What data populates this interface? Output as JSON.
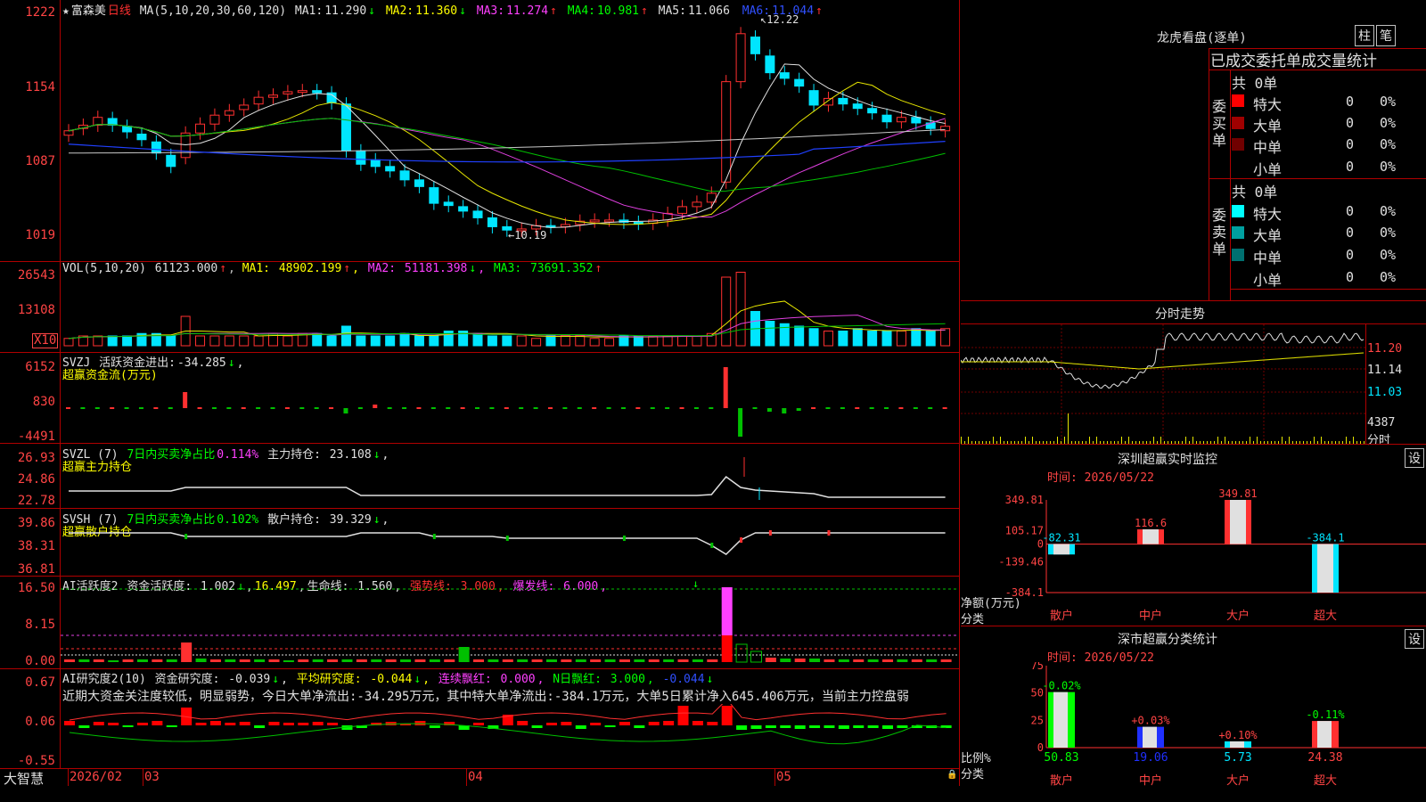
{
  "stock": {
    "star": "★",
    "name": "富森美",
    "period": "日线"
  },
  "ma": {
    "params": "MA(5,10,20,30,60,120)",
    "items": [
      {
        "label": "MA1:",
        "value": "11.290",
        "arrow": "↓",
        "color": "#e0e0e0"
      },
      {
        "label": "MA2:",
        "value": "11.360",
        "arrow": "↓",
        "color": "#ffff00"
      },
      {
        "label": "MA3:",
        "value": "11.274",
        "arrow": "↑",
        "color": "#ff40ff"
      },
      {
        "label": "MA4:",
        "value": "10.981",
        "arrow": "↑",
        "color": "#00ff00"
      },
      {
        "label": "MA5:",
        "value": "11.066",
        "arrow": "",
        "color": "#e0e0e0"
      },
      {
        "label": "MA6:",
        "value": "11.044",
        "arrow": "↑",
        "color": "#3050ff"
      }
    ]
  },
  "price_axis": [
    "1222",
    "1154",
    "1087",
    "1019"
  ],
  "price_marks": {
    "high": "12.22",
    "low": "10.19"
  },
  "vol": {
    "label": "VOL(5,10,20)",
    "value": "61123.000",
    "arrow": "↑",
    "items": [
      {
        "label": "MA1:",
        "value": "48902.199",
        "arrow": "↑",
        "color": "#ffff00"
      },
      {
        "label": "MA2:",
        "value": "51181.398",
        "arrow": "↓",
        "color": "#ff40ff"
      },
      {
        "label": "MA3:",
        "value": "73691.352",
        "arrow": "↑",
        "color": "#00ff00"
      }
    ],
    "axis": [
      "26543",
      "13108"
    ],
    "unit": "X10"
  },
  "svzj": {
    "label": "SVZJ",
    "text": "活跃资金进出:",
    "value": "-34.285",
    "arrow": "↓",
    "suffix": ",",
    "sub": "超赢资金流(万元)",
    "axis": [
      "6152",
      "830",
      "-4491"
    ]
  },
  "svzl": {
    "label": "SVZL (7)",
    "text1": "7日内买卖净占比",
    "v1": "0.114%",
    "text2": "主力持仓:",
    "v2": "23.108",
    "arrow": "↓",
    "suffix": ",",
    "sub": "超赢主力持仓",
    "axis": [
      "26.93",
      "24.86",
      "22.78"
    ]
  },
  "svsh": {
    "label": "SVSH (7)",
    "text1": "7日内买卖净占比",
    "v1": "0.102%",
    "text2": "散户持仓:",
    "v2": "39.329",
    "arrow": "↓",
    "suffix": ",",
    "sub": "超赢散户持仓",
    "axis": [
      "39.86",
      "38.31",
      "36.81"
    ]
  },
  "ai1": {
    "label": "AI活跃度2",
    "t1": "资金活跃度:",
    "v1": "1.002",
    "a1": "↓",
    "suffix1": ",",
    "v2": "16.497",
    "suffix2": ",",
    "t3": "生命线:",
    "v3": "1.560",
    "suffix3": ",",
    "t4": "强势线:",
    "v4": "3.000",
    "suffix4": ",",
    "t5": "爆发线:",
    "v5": "6.000",
    "suffix5": ",",
    "axis": [
      "16.50",
      "8.15",
      "0.00"
    ]
  },
  "ai2": {
    "label": "AI研究度2(10)",
    "t1": "资金研究度:",
    "v1": "-0.039",
    "a1": "↓",
    "suffix1": ",",
    "t2": "平均研究度:",
    "v2": "-0.044",
    "a2": "↓",
    "suffix2": ",",
    "t3": "连续飘红:",
    "v3": "0.000",
    "suffix3": ",",
    "t4": "N日飘红:",
    "v4": "3.000",
    "suffix4": ",",
    "v5": "-0.044",
    "a5": "↓",
    "axis": [
      "0.67",
      "0.06",
      "-0.55"
    ],
    "comment": "近期大资金关注度较低，明显弱势，今日大单净流出:-34.295万元，其中特大单净流出:-384.1万元，大单5日累计净入645.406万元，当前主力控盘弱"
  },
  "bottom": {
    "brand": "大智慧",
    "dates": [
      "2026/02",
      "03",
      "04",
      "05"
    ]
  },
  "lhb": {
    "title": "龙虎看盘(逐单)",
    "btn1": "柱",
    "btn2": "笔",
    "tabs": "已成交委托单成交量统计",
    "buy": {
      "side": "委买单",
      "total": "共 0单",
      "rows": [
        {
          "name": "特大",
          "v": "0",
          "p": "0%"
        },
        {
          "name": "大单",
          "v": "0",
          "p": "0%"
        },
        {
          "name": "中单",
          "v": "0",
          "p": "0%"
        },
        {
          "name": "小单",
          "v": "0",
          "p": "0%"
        }
      ]
    },
    "sell": {
      "side": "委卖单",
      "total": "共 0单",
      "rows": [
        {
          "name": "特大",
          "v": "0",
          "p": "0%"
        },
        {
          "name": "大单",
          "v": "0",
          "p": "0%"
        },
        {
          "name": "中单",
          "v": "0",
          "p": "0%"
        },
        {
          "name": "小单",
          "v": "0",
          "p": "0%"
        }
      ]
    }
  },
  "intraday": {
    "title": "分时走势",
    "axis": [
      "11.20",
      "11.14",
      "11.03"
    ],
    "vol": "4387",
    "vol_unit": "分时"
  },
  "monitor": {
    "title": "深圳超赢实时监控",
    "settings": "设",
    "time": "时间: 2026/05/22",
    "ylabel": "净额(万元)",
    "xlabel": "分类",
    "axis": [
      "349.81",
      "105.17",
      "0",
      "-139.46",
      "-384.1"
    ],
    "bars": [
      {
        "name": "散户",
        "value": -82.31,
        "label": "-82.31"
      },
      {
        "name": "中户",
        "value": 116.6,
        "label": "116.6"
      },
      {
        "name": "大户",
        "value": 349.81,
        "label": "349.81"
      },
      {
        "name": "超大",
        "value": -384.1,
        "label": "-384.1"
      }
    ]
  },
  "classify": {
    "title": "深市超赢分类统计",
    "settings": "设",
    "time": "时间: 2026/05/22",
    "ylabel": "比例%",
    "xlabel": "分类",
    "axis": [
      "75",
      "50",
      "25",
      "0"
    ],
    "bars": [
      {
        "name": "散户",
        "value": 50.83,
        "label": "50.83",
        "change": "-0.02%"
      },
      {
        "name": "中户",
        "value": 19.06,
        "label": "19.06",
        "change": "+0.03%"
      },
      {
        "name": "大户",
        "value": 5.73,
        "label": "5.73",
        "change": "+0.10%"
      },
      {
        "name": "超大",
        "value": 24.38,
        "label": "24.38",
        "change": "-0.11%"
      }
    ]
  }
}
